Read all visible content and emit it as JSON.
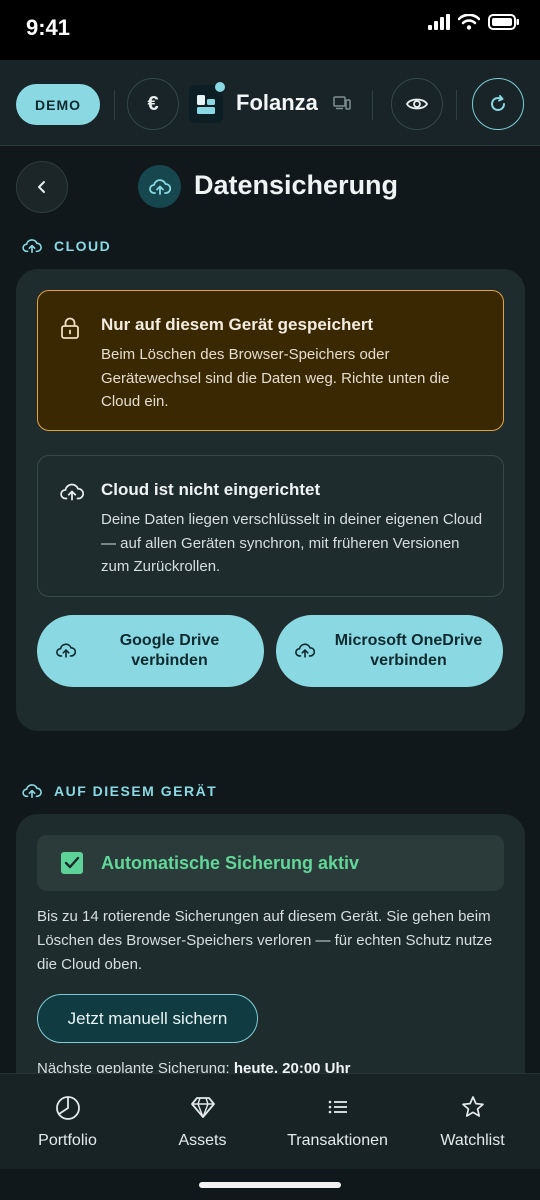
{
  "status_bar": {
    "time": "9:41"
  },
  "app_bar": {
    "mode_badge": "DEMO",
    "currency_symbol": "€",
    "app_name": "Folanza"
  },
  "header": {
    "title": "Datensicherung"
  },
  "cloud_section": {
    "label": "CLOUD",
    "warning": {
      "title": "Nur auf diesem Gerät gespeichert",
      "text": "Beim Löschen des Browser-Speichers oder Gerätewechsel sind die Daten weg. Richte unten die Cloud ein."
    },
    "info": {
      "title": "Cloud ist nicht eingerichtet",
      "text": "Deine Daten liegen verschlüsselt in deiner eigenen Cloud — auf allen Geräten synchron, mit früheren Versionen zum Zurückrollen."
    },
    "google_button": "Google Drive verbinden",
    "onedrive_button": "Microsoft OneDrive verbinden"
  },
  "device_section": {
    "label": "AUF DIESEM GERÄT",
    "auto_backup_label": "Automatische Sicherung aktiv",
    "auto_backup_checked": true,
    "description": "Bis zu 14 rotierende Sicherungen auf diesem Gerät. Sie gehen beim Löschen des Browser-Speichers verloren — für echten Schutz nutze die Cloud oben.",
    "manual_button": "Jetzt manuell sichern",
    "next_backup_label": "Nächste geplante Sicherung:",
    "next_backup_value": "heute, 20:00 Uhr"
  },
  "tab_bar": {
    "tabs": [
      {
        "label": "Portfolio",
        "icon": "pie-chart-icon"
      },
      {
        "label": "Assets",
        "icon": "diamond-icon"
      },
      {
        "label": "Transaktionen",
        "icon": "list-icon"
      },
      {
        "label": "Watchlist",
        "icon": "star-icon"
      }
    ]
  },
  "colors": {
    "accent": "#8ad9e2",
    "background": "#11181b",
    "card": "#1f2c2e",
    "warning_bg": "#3a2803",
    "warning_border": "#e0a43f",
    "success": "#5dd39a"
  }
}
